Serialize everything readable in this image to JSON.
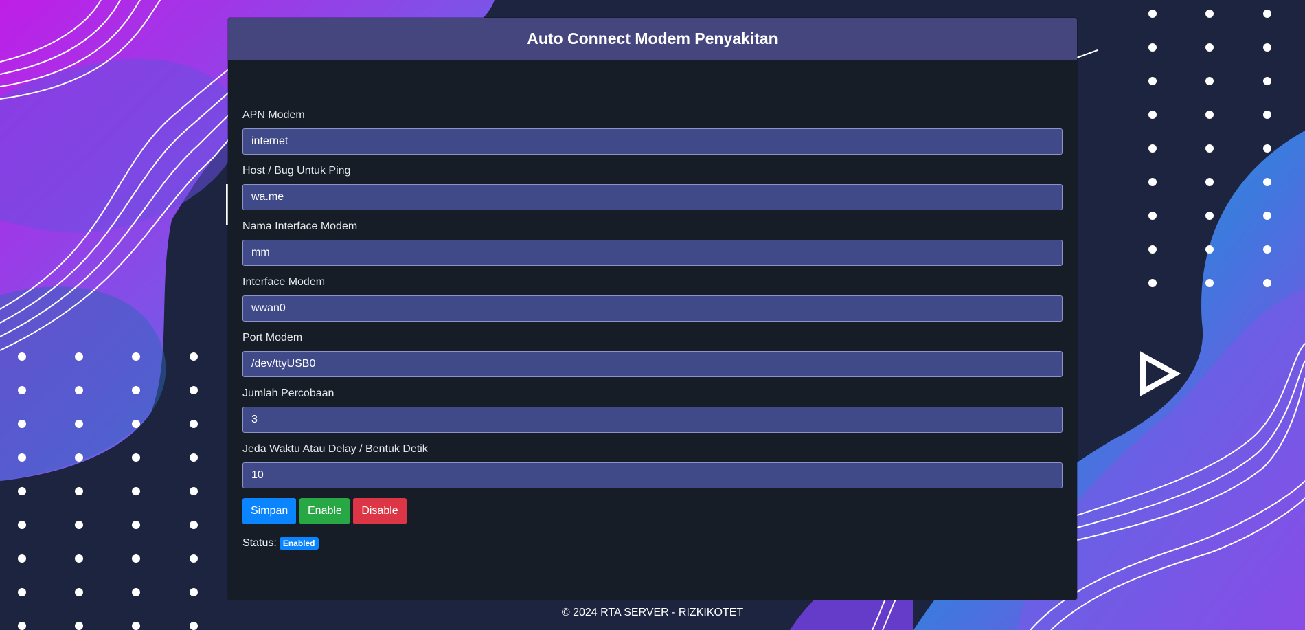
{
  "header": {
    "title": "Auto Connect Modem Penyakitan"
  },
  "form": {
    "fields": [
      {
        "label": "APN Modem",
        "value": "internet"
      },
      {
        "label": "Host / Bug Untuk Ping",
        "value": "wa.me"
      },
      {
        "label": "Nama Interface Modem",
        "value": "mm"
      },
      {
        "label": "Interface Modem",
        "value": "wwan0"
      },
      {
        "label": "Port Modem",
        "value": "/dev/ttyUSB0"
      },
      {
        "label": "Jumlah Percobaan",
        "value": "3"
      },
      {
        "label": "Jeda Waktu Atau Delay / Bentuk Detik",
        "value": "10"
      }
    ]
  },
  "buttons": {
    "save": "Simpan",
    "enable": "Enable",
    "disable": "Disable"
  },
  "status": {
    "label": "Status:",
    "badge": "Enabled"
  },
  "footer": {
    "text": "© 2024 RTA SERVER - RIZKIKOTET"
  },
  "colors": {
    "background": "#1c2440",
    "card": "#161d27",
    "header": "#46467e",
    "input": "#414a88",
    "primary": "#0a84ff",
    "success": "#28a745",
    "danger": "#dc3545"
  },
  "icons": {
    "decor": "play-triangle-icon"
  }
}
